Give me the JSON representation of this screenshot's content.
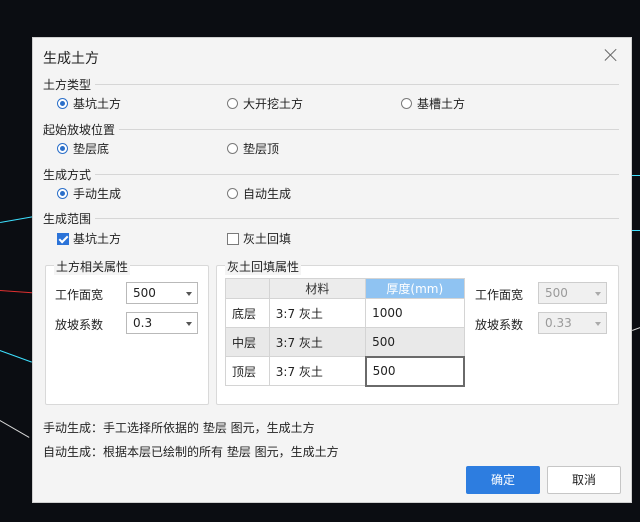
{
  "dialog": {
    "title": "生成土方"
  },
  "earthwork_type": {
    "label": "土方类型",
    "options": [
      "基坑土方",
      "大开挖土方",
      "基槽土方"
    ],
    "selected": "基坑土方"
  },
  "slope_start": {
    "label": "起始放坡位置",
    "options": [
      "垫层底",
      "垫层顶"
    ],
    "selected": "垫层底"
  },
  "gen_method": {
    "label": "生成方式",
    "options": [
      "手动生成",
      "自动生成"
    ],
    "selected": "手动生成"
  },
  "gen_scope": {
    "label": "生成范围",
    "items": [
      {
        "label": "基坑土方",
        "checked": true
      },
      {
        "label": "灰土回填",
        "checked": false
      }
    ]
  },
  "earth_props": {
    "title": "土方相关属性",
    "work_width_label": "工作面宽",
    "work_width_value": "500",
    "slope_coef_label": "放坡系数",
    "slope_coef_value": "0.3"
  },
  "lime_props": {
    "title": "灰土回填属性",
    "columns": [
      "",
      "材料",
      "厚度(mm)"
    ],
    "rows": [
      {
        "layer": "底层",
        "material": "3:7 灰土",
        "thickness": "1000"
      },
      {
        "layer": "中层",
        "material": "3:7 灰土",
        "thickness": "500"
      },
      {
        "layer": "顶层",
        "material": "3:7 灰土",
        "thickness": "500"
      }
    ],
    "work_width_label": "工作面宽",
    "work_width_value": "500",
    "slope_coef_label": "放坡系数",
    "slope_coef_value": "0.33"
  },
  "notes": {
    "manual": "手动生成：手工选择所依据的 垫层 图元，生成土方",
    "auto": "自动生成：根据本层已绘制的所有 垫层 图元，生成土方"
  },
  "buttons": {
    "ok": "确定",
    "cancel": "取消"
  },
  "colors": {
    "accent": "#2d7de0",
    "selected_header": "#8fc3f2",
    "backdrop": "#0b0d12"
  }
}
